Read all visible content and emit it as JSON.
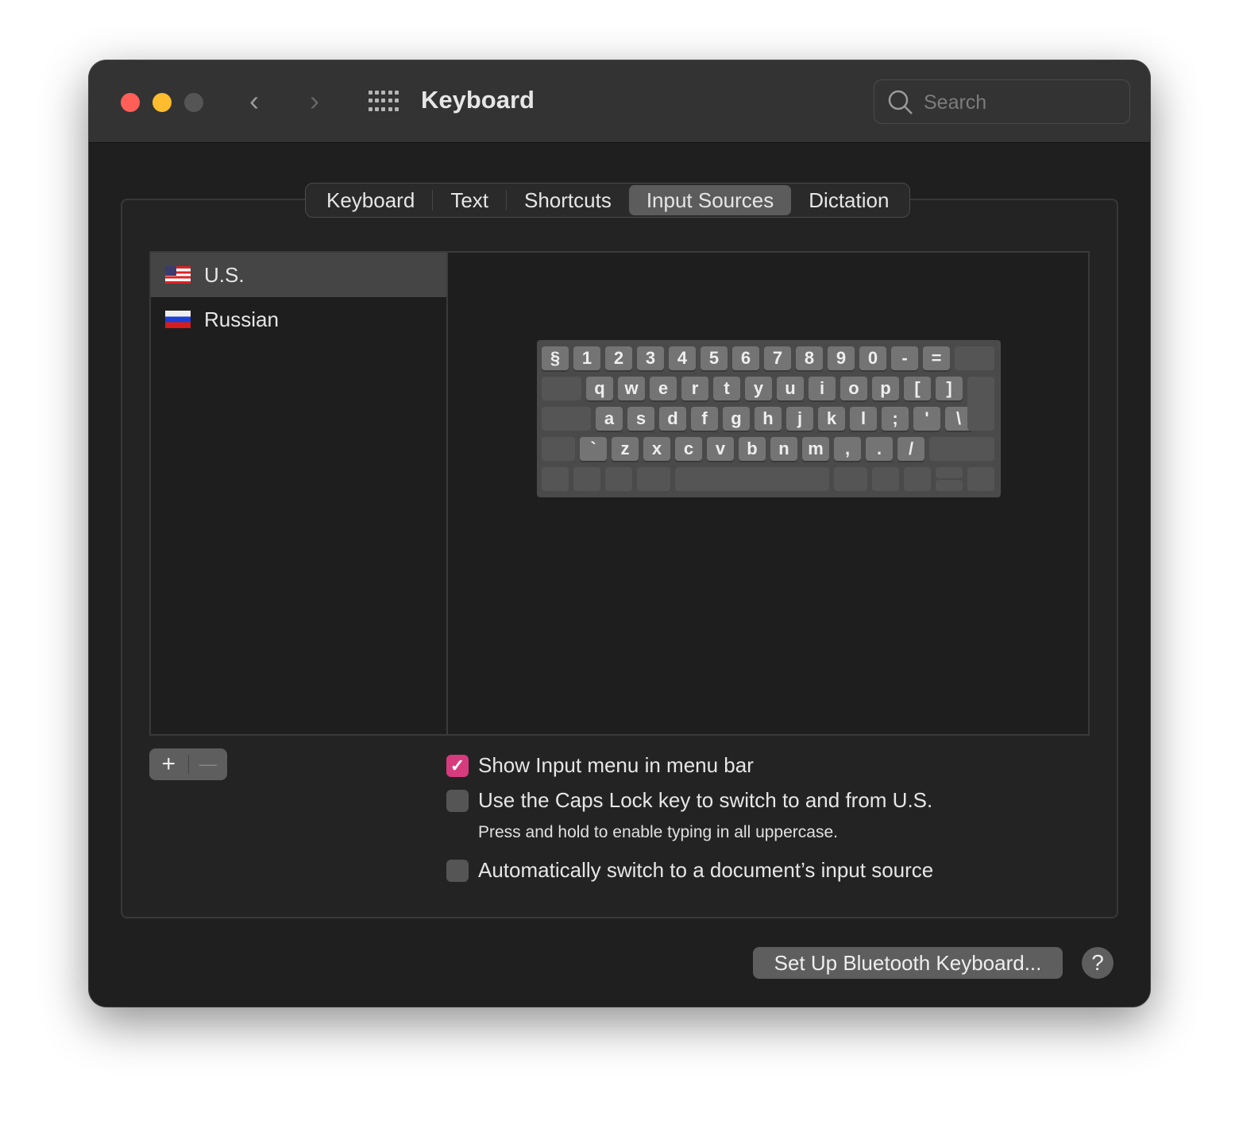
{
  "window": {
    "title": "Keyboard",
    "search_placeholder": "Search"
  },
  "colors": {
    "close": "#ff5f57",
    "minimize": "#febc2e",
    "zoom_disabled": "#555555",
    "accent": "#d63b7d"
  },
  "tabs": [
    {
      "label": "Keyboard",
      "selected": false
    },
    {
      "label": "Text",
      "selected": false
    },
    {
      "label": "Shortcuts",
      "selected": false
    },
    {
      "label": "Input Sources",
      "selected": true
    },
    {
      "label": "Dictation",
      "selected": false
    }
  ],
  "sources": [
    {
      "label": "U.S.",
      "flag": "us-flag",
      "selected": true
    },
    {
      "label": "Russian",
      "flag": "russia-flag",
      "selected": false
    }
  ],
  "list_buttons": {
    "add": "+",
    "remove": "—"
  },
  "keyboard_rows": [
    [
      "§",
      "1",
      "2",
      "3",
      "4",
      "5",
      "6",
      "7",
      "8",
      "9",
      "0",
      "-",
      "="
    ],
    [
      "q",
      "w",
      "e",
      "r",
      "t",
      "y",
      "u",
      "i",
      "o",
      "p",
      "[",
      "]"
    ],
    [
      "a",
      "s",
      "d",
      "f",
      "g",
      "h",
      "j",
      "k",
      "l",
      ";",
      "'",
      "\\"
    ],
    [
      "`",
      "z",
      "x",
      "c",
      "v",
      "b",
      "n",
      "m",
      ",",
      ".",
      "/"
    ]
  ],
  "options": [
    {
      "label": "Show Input menu in menu bar",
      "checked": true
    },
    {
      "label": "Use the Caps Lock key to switch to and from U.S.",
      "checked": false,
      "hint": "Press and hold to enable typing in all uppercase."
    },
    {
      "label": "Automatically switch to a document’s input source",
      "checked": false
    }
  ],
  "bluetooth_button": "Set Up Bluetooth Keyboard...",
  "help_button": "?"
}
